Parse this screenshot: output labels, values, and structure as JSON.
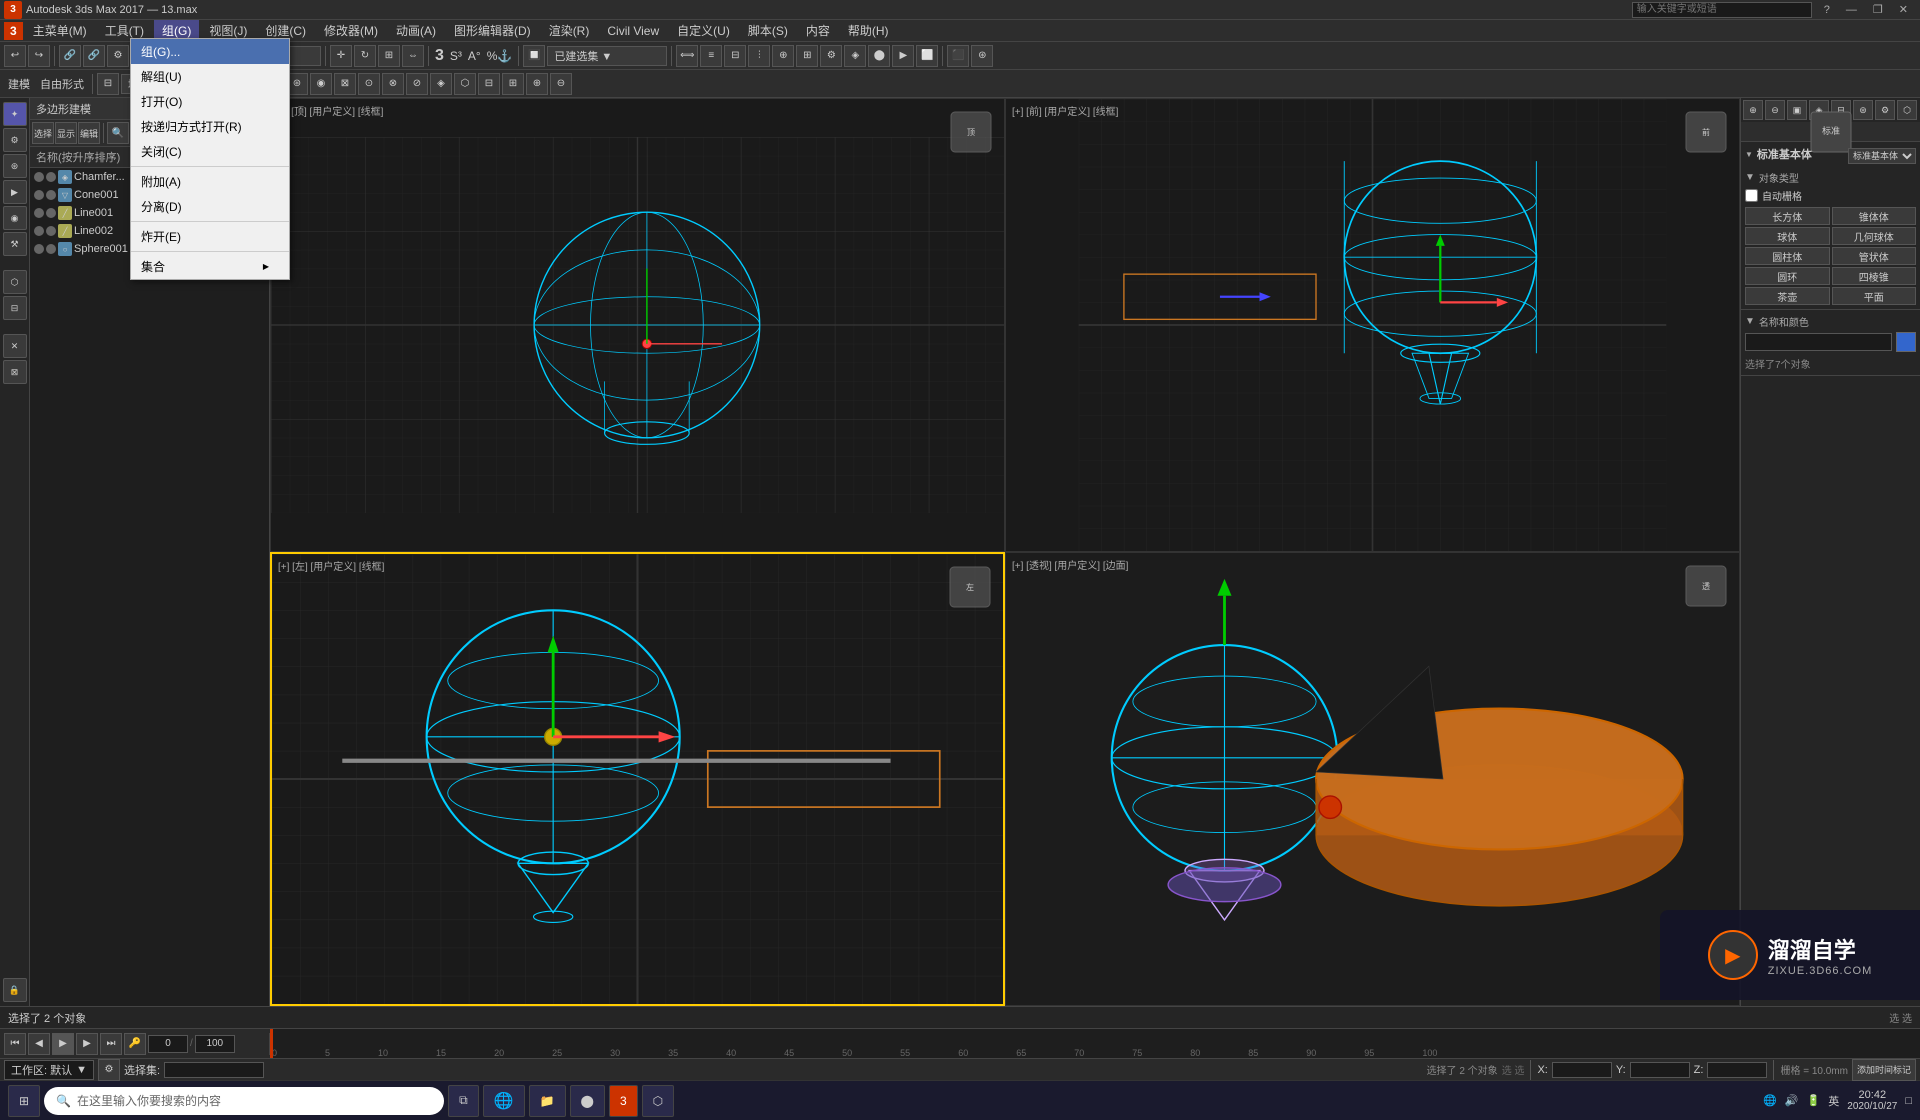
{
  "titlebar": {
    "logo": "3",
    "title": "Autodesk 3ds Max 2017 — 13.max",
    "search_placeholder": "输入关键字或短语",
    "btn_minimize": "—",
    "btn_restore": "❐",
    "btn_close": "✕",
    "btn_help": "?"
  },
  "menubar": {
    "items": [
      {
        "label": "3",
        "id": "logo-menu"
      },
      {
        "label": "主菜单(M)",
        "id": "main-menu"
      },
      {
        "label": "工具(T)",
        "id": "tools-menu"
      },
      {
        "label": "组(G)",
        "id": "group-menu",
        "active": true
      },
      {
        "label": "视图(J)",
        "id": "view-menu"
      },
      {
        "label": "创建(C)",
        "id": "create-menu"
      },
      {
        "label": "修改器(M)",
        "id": "modifier-menu"
      },
      {
        "label": "动画(A)",
        "id": "animation-menu"
      },
      {
        "label": "图形编辑器(D)",
        "id": "graph-editor-menu"
      },
      {
        "label": "渲染(R)",
        "id": "render-menu"
      },
      {
        "label": "Civil View",
        "id": "civil-view-menu"
      },
      {
        "label": "自定义(U)",
        "id": "customize-menu"
      },
      {
        "label": "脚本(S)",
        "id": "script-menu"
      },
      {
        "label": "内容",
        "id": "content-menu"
      },
      {
        "label": "帮助(H)",
        "id": "help-menu"
      }
    ]
  },
  "context_menu": {
    "items": [
      {
        "label": "组(G)...",
        "shortcut": "",
        "highlighted": true,
        "id": "group-group"
      },
      {
        "label": "解组(U)",
        "shortcut": "",
        "id": "group-ungroup"
      },
      {
        "label": "打开(O)",
        "shortcut": "",
        "id": "group-open"
      },
      {
        "label": "按递归方式打开(R)",
        "shortcut": "",
        "id": "group-open-recursive"
      },
      {
        "label": "关闭(C)",
        "shortcut": "",
        "id": "group-close"
      },
      {
        "label": "附加(A)",
        "shortcut": "",
        "id": "group-attach"
      },
      {
        "label": "分离(D)",
        "shortcut": "",
        "id": "group-detach"
      },
      {
        "label": "炸开(E)",
        "shortcut": "",
        "id": "group-explode"
      },
      {
        "label": "集合",
        "shortcut": "",
        "arrow": true,
        "id": "group-assembly"
      }
    ]
  },
  "scene_panel": {
    "title": "多边形建模",
    "toolbar_labels": [
      "选择",
      "显示",
      "编辑"
    ],
    "col_header": "名称(按升序排序)",
    "items": [
      {
        "name": "Chamfer...",
        "type": "editable",
        "visible": true,
        "lock": false
      },
      {
        "name": "Cone001",
        "type": "cone",
        "visible": true,
        "lock": false
      },
      {
        "name": "Line001",
        "type": "line",
        "visible": true,
        "lock": false
      },
      {
        "name": "Line002",
        "type": "line",
        "visible": true,
        "lock": false
      },
      {
        "name": "Sphere001",
        "type": "sphere",
        "visible": true,
        "lock": false
      }
    ]
  },
  "right_panel": {
    "create_label": "建模",
    "freeform_label": "自由形式",
    "selection_label": "选择集",
    "section_create": {
      "title": "标准基本体",
      "subsection": "对象类型",
      "auto_grid": "自动栅格",
      "types": [
        "长方体",
        "锥体体",
        "球体",
        "几何球体",
        "圆柱体",
        "管状体",
        "圆环",
        "四棱锥",
        "茶壶",
        "平面"
      ],
      "section2": "名称和颜色",
      "select_info": "选择了7个对象"
    }
  },
  "viewports": [
    {
      "id": "vp-top",
      "label": "[+] [顶] [用户定义] [线框]",
      "active": false
    },
    {
      "id": "vp-front",
      "label": "[+] [前] [用户定义] [线框]",
      "active": false
    },
    {
      "id": "vp-left",
      "label": "[+] [左] [用户定义] [线框]",
      "active": true
    },
    {
      "id": "vp-perspective",
      "label": "[+] [透视] [用户定义] [边面]",
      "active": false
    }
  ],
  "timeline": {
    "range": "0 / 100",
    "ticks": [
      "0",
      "5",
      "10",
      "15",
      "20",
      "25",
      "30",
      "35",
      "40",
      "45",
      "50",
      "55",
      "60",
      "65",
      "70",
      "75",
      "80",
      "85",
      "90",
      "95",
      "100"
    ]
  },
  "statusbar": {
    "msg1": "选择了 2 个对象",
    "msg2": "选 选",
    "x_label": "X:",
    "x_val": "",
    "y_label": "Y:",
    "y_val": "",
    "z_label": "Z:",
    "z_val": "",
    "grid_label": "栅格 = 10.0mm",
    "time_msg": "添加时间标记"
  },
  "bottombar": {
    "workspace_label": "工作区: 默认",
    "select_set_label": "选择集:"
  },
  "taskbar": {
    "time": "20:42",
    "date": "2020/10/27",
    "search_placeholder": "在这里输入你要搜索的内容",
    "lang": "英"
  },
  "watermark": {
    "icon": "▶",
    "name": "溜溜自学",
    "sub": "ZIXUE.3D66.COM"
  }
}
